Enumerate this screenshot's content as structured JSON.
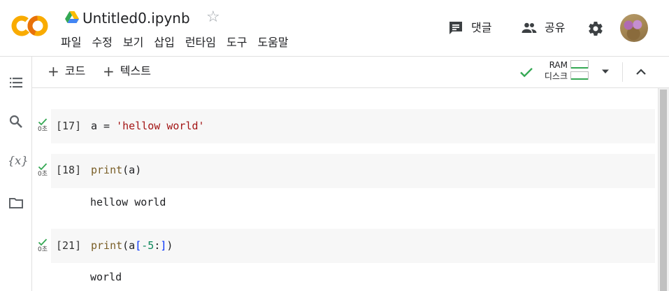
{
  "app": {
    "notebook_title": "Untitled0.ipynb",
    "menu": [
      "파일",
      "수정",
      "보기",
      "삽입",
      "런타임",
      "도구",
      "도움말"
    ],
    "comment_label": "댓글",
    "share_label": "공유"
  },
  "toolbar": {
    "add_code_label": "코드",
    "add_text_label": "텍스트",
    "ram_label": "RAM",
    "disk_label": "디스크"
  },
  "cells": [
    {
      "exec_count": "[17]",
      "status_time": "0초",
      "code_tokens": [
        {
          "text": "a = ",
          "kind": "plain"
        },
        {
          "text": "'hellow world'",
          "kind": "string"
        }
      ],
      "output": ""
    },
    {
      "exec_count": "[18]",
      "status_time": "0초",
      "code_tokens": [
        {
          "text": "print",
          "kind": "function"
        },
        {
          "text": "(a)",
          "kind": "plain"
        }
      ],
      "output": "hellow world"
    },
    {
      "exec_count": "[21]",
      "status_time": "0초",
      "code_tokens": [
        {
          "text": "print",
          "kind": "function"
        },
        {
          "text": "(a",
          "kind": "plain"
        },
        {
          "text": "[",
          "kind": "bracket"
        },
        {
          "text": "-5",
          "kind": "number"
        },
        {
          "text": ":",
          "kind": "plain"
        },
        {
          "text": "]",
          "kind": "bracket"
        },
        {
          "text": ")",
          "kind": "plain"
        }
      ],
      "output": "world"
    }
  ],
  "colors": {
    "accent_orange": "#f9ab00",
    "check_green": "#34a853",
    "string": "#a31515",
    "function": "#795e26",
    "number": "#098658"
  }
}
